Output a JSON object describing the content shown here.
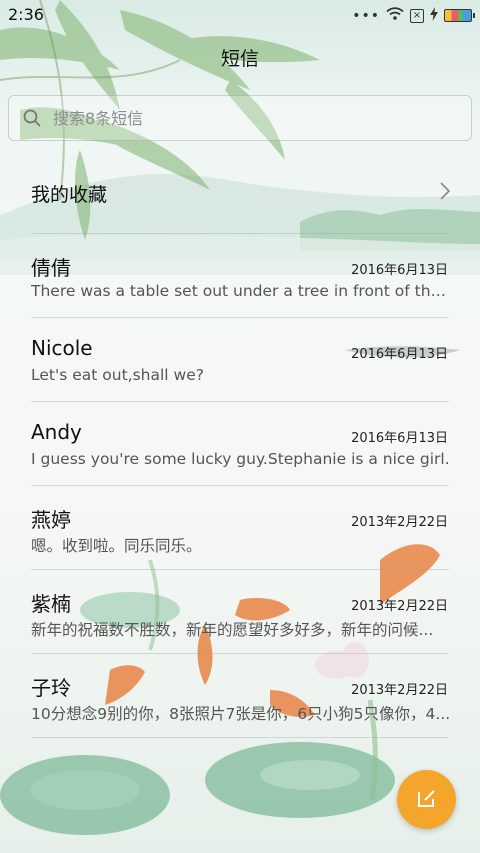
{
  "status": {
    "time": "2:36",
    "sim_label": "×"
  },
  "header": {
    "title": "短信"
  },
  "search": {
    "placeholder": "搜索8条短信"
  },
  "favorites": {
    "label": "我的收藏"
  },
  "messages": [
    {
      "name": "倩倩",
      "date": "2016年6月13日",
      "snippet": "There was a table set out under a tree in front of the ho..."
    },
    {
      "name": "Nicole",
      "date": "2016年6月13日",
      "snippet": "Let's eat out,shall we?"
    },
    {
      "name": "Andy",
      "date": "2016年6月13日",
      "snippet": "I guess you're some lucky guy.Stephanie is a nice girl."
    },
    {
      "name": "燕婷",
      "date": "2013年2月22日",
      "snippet": "嗯。收到啦。同乐同乐。"
    },
    {
      "name": "紫楠",
      "date": "2013年2月22日",
      "snippet": "新年的祝福数不胜数，新年的愿望好多好多，新年的问候..."
    },
    {
      "name": "子玲",
      "date": "2013年2月22日",
      "snippet": "10分想念9别的你，8张照片7张是你，6只小狗5只像你，4..."
    }
  ],
  "fab": {
    "icon": "compose-icon",
    "color": "#f4a52b"
  },
  "theme": {
    "accent": "#f4a52b",
    "text": "#111111"
  }
}
